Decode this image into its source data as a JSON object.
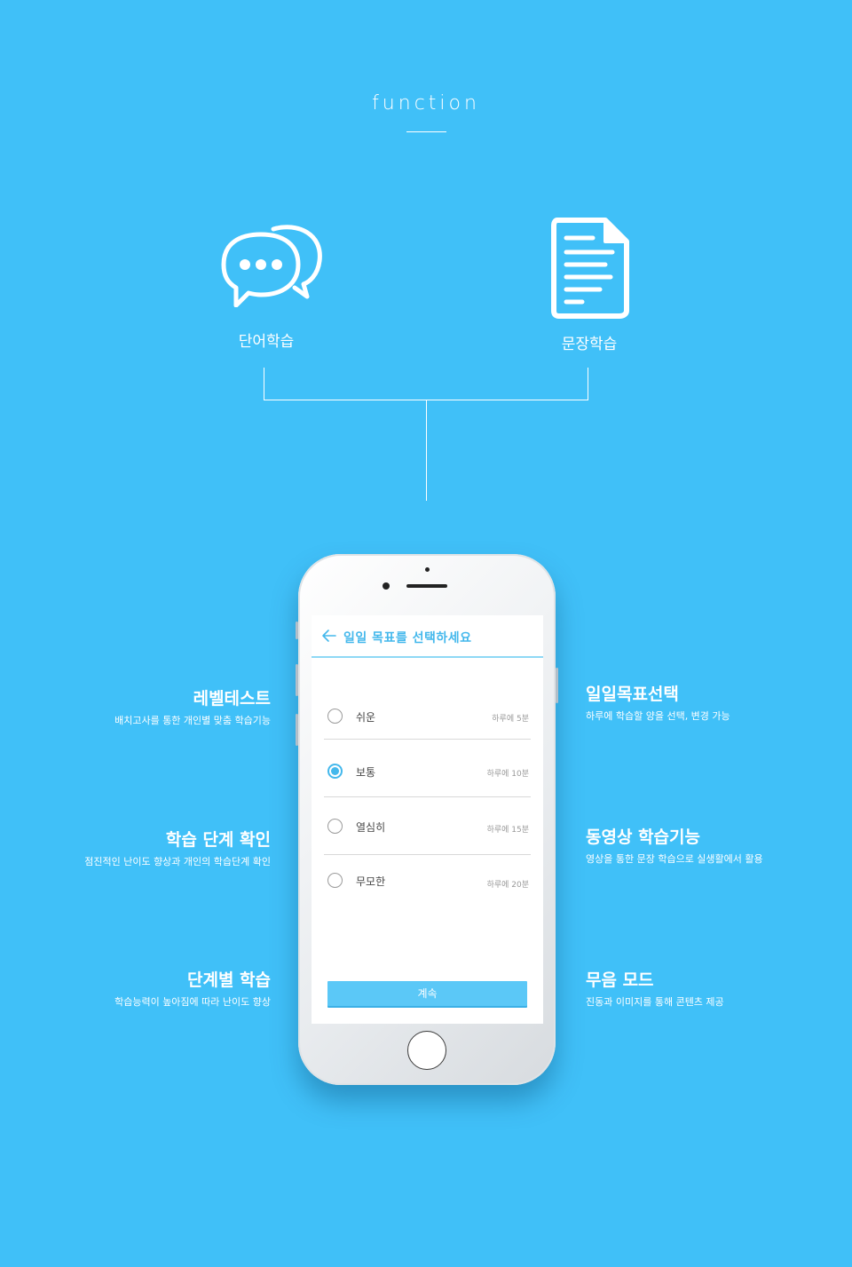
{
  "header": {
    "title": "function"
  },
  "features": [
    {
      "label": "단어학습",
      "icon": "chat-bubbles-icon"
    },
    {
      "label": "문장학습",
      "icon": "document-icon"
    }
  ],
  "left_items": [
    {
      "title": "레벨테스트",
      "desc": "배치고사를 통한 개인별 맞춤 학습기능"
    },
    {
      "title": "학습 단계 확인",
      "desc": "점진적인 난이도 향상과 개인의 학습단계 확인"
    },
    {
      "title": "단계별 학습",
      "desc": "학습능력이 높아짐에 따라 난이도 향상"
    }
  ],
  "right_items": [
    {
      "title": "일일목표선택",
      "desc": "하루에 학습할 양을 선택, 변경 가능"
    },
    {
      "title": "동영상 학습기능",
      "desc": "영상을 통한 문장 학습으로 실생활에서 활용"
    },
    {
      "title": "무음 모드",
      "desc": "진동과 이미지를 통해 콘텐츠 제공"
    }
  ],
  "app": {
    "title": "일일 목표를 선택하세요",
    "options": [
      {
        "label": "쉬운",
        "time": "하루에 5분",
        "selected": false
      },
      {
        "label": "보통",
        "time": "하루에 10분",
        "selected": true
      },
      {
        "label": "열심히",
        "time": "하루에 15분",
        "selected": false
      },
      {
        "label": "무모한",
        "time": "하루에 20분",
        "selected": false
      }
    ],
    "continue_label": "계속"
  },
  "colors": {
    "background": "#40c0f8",
    "accent": "#44b8ec",
    "button": "#5bc8f7"
  }
}
